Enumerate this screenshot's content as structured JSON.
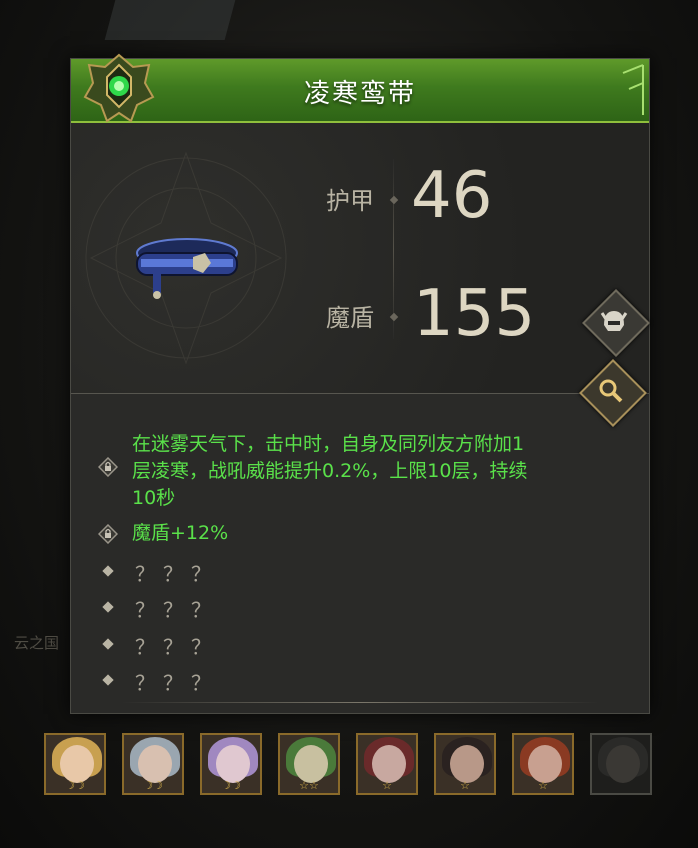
{
  "item": {
    "name": "凌寒鸾带",
    "stats": [
      {
        "label": "护甲",
        "value": "46"
      },
      {
        "label": "魔盾",
        "value": "155"
      }
    ]
  },
  "effects": [
    {
      "locked": true,
      "text_lines": [
        "在迷雾天气下，击中时，自身及同列友方附加1",
        "层凌寒，战吼威能提升0.2%，上限10层，持续",
        "10秒"
      ]
    },
    {
      "locked": true,
      "text_lines": [
        "魔盾+12%"
      ]
    },
    {
      "locked": false,
      "text_lines": [
        "？？？"
      ]
    },
    {
      "locked": false,
      "text_lines": [
        "？？？"
      ]
    },
    {
      "locked": false,
      "text_lines": [
        "？？？"
      ]
    },
    {
      "locked": false,
      "text_lines": [
        "？？？"
      ]
    }
  ],
  "background": {
    "partial_label": "云之国"
  },
  "buttons": {
    "class_icon": "helmet-icon",
    "inspect_icon": "magnifier-icon"
  },
  "colors": {
    "header_green": "#4a8a22",
    "effect_text": "#5ae14a",
    "panel_bg": "#2a2a28"
  },
  "portraits": [
    {
      "stars": "☽☽"
    },
    {
      "stars": "☽☽"
    },
    {
      "stars": "☽☽"
    },
    {
      "stars": "☆☆"
    },
    {
      "stars": "☆"
    },
    {
      "stars": "☆"
    },
    {
      "stars": "☆"
    },
    {
      "stars": ""
    }
  ]
}
